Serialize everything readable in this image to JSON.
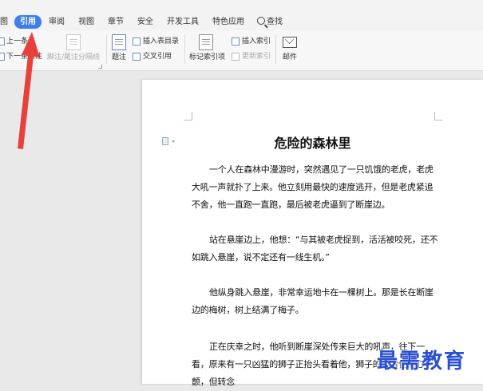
{
  "tabs": [
    {
      "label": "图"
    },
    {
      "label": "引用"
    },
    {
      "label": "审阅"
    },
    {
      "label": "视图"
    },
    {
      "label": "章节"
    },
    {
      "label": "安全"
    },
    {
      "label": "开发工具"
    },
    {
      "label": "特色应用"
    },
    {
      "label": "查找"
    }
  ],
  "ribbon": {
    "prev_footnote": "上一条注",
    "next_footnote": "下一条尾注",
    "separator_line": "脚注/尾注分隔线",
    "caption": "题注",
    "insert_toc_table": "插入表目录",
    "cross_reference": "交叉引用",
    "mark_index": "标记索引项",
    "insert_index": "插入索引",
    "update_index": "更新索引",
    "mail": "邮件"
  },
  "document": {
    "title": "危险的森林里",
    "paragraphs": [
      "一个人在森林中漫游时，突然遇见了一只饥饿的老虎，老虎大吼一声就扑了上来。他立刻用最快的速度逃开，但是老虎紧追不舍，他一直跑一直跑，最后被老虎逼到了断崖边。",
      "站在悬崖边上，他想：“与其被老虎捉到，活活被咬死，还不如跳入悬崖，说不定还有一线生机。”",
      "他纵身跳入悬崖，非常幸运地卡在一棵树上。那是长在断崖边的梅树，树上结满了梅子。",
      "正在庆幸之时，他听到断崖深处传来巨大的吼声，往下一看，原来有一只凶猛的狮子正抬头看着他，狮子的声音使他心颤，但转念"
    ]
  },
  "watermark": "最需教育",
  "colors": {
    "active_tab": "#3f7ee8",
    "arrow": "#e8413b",
    "watermark": "#2a4fd0"
  }
}
